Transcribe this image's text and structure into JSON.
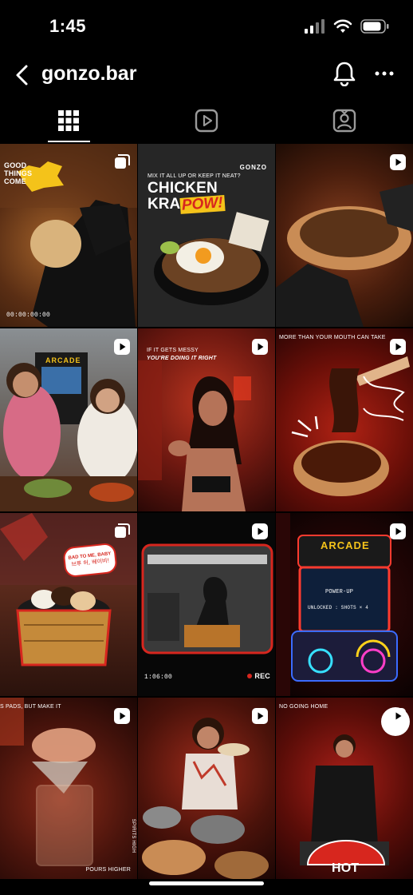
{
  "status_bar": {
    "time": "1:45"
  },
  "header": {
    "title": "gonzo.bar"
  },
  "tabs": [
    {
      "name": "grid",
      "active": true
    },
    {
      "name": "reels",
      "active": false
    },
    {
      "name": "tagged",
      "active": false
    }
  ],
  "colors": {
    "background": "#000000",
    "accent_red": "#d7261e",
    "text": "#ffffff"
  },
  "posts": [
    {
      "type": "carousel",
      "caption_top": "GOOD THINGS COME",
      "timestamp": "00:00:00:00"
    },
    {
      "type": "carousel",
      "caption_top": "MIX IT ALL UP OR KEEP IT NEAT?",
      "title_line1": "CHICKEN",
      "title_line2": "KRA",
      "title_highlight": "POW!",
      "brand": "GONZO"
    },
    {
      "type": "reel"
    },
    {
      "type": "reel",
      "sign": "ARCADE"
    },
    {
      "type": "reel",
      "caption_top": "IF IT GETS MESSY",
      "caption_sub": "YOU'RE DOING IT RIGHT"
    },
    {
      "type": "reel",
      "caption_top": "MORE THAN YOUR MOUTH CAN TAKE"
    },
    {
      "type": "carousel",
      "bubble_line1": "BAD TO ME, BABY",
      "bubble_line2": "브루 허, 베이비!"
    },
    {
      "type": "reel",
      "timestamp": "1:06:00",
      "rec": "REC"
    },
    {
      "type": "reel",
      "sign": "ARCADE",
      "screen_line1": "POWER-UP",
      "screen_line2": "UNLOCKED : SHOTS × 4"
    },
    {
      "type": "reel",
      "caption_top": "S PADS, BUT MAKE IT",
      "caption_bottom": "POURS HIGHER",
      "caption_side": "SPIRITS HIGH"
    },
    {
      "type": "reel"
    },
    {
      "type": "reel",
      "caption_top": "NO GOING HOME",
      "badge": "HOT"
    }
  ]
}
